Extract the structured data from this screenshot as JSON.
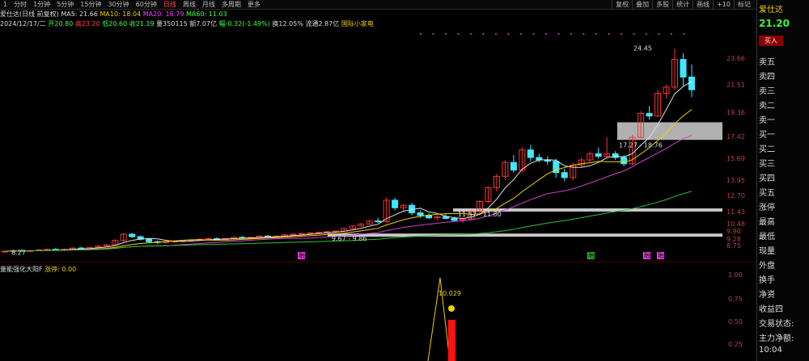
{
  "topbar": {
    "tabs": [
      "1",
      "分时",
      "1分钟",
      "5分钟",
      "15分钟",
      "30分钟",
      "60分钟",
      "日线",
      "周线",
      "月线",
      "多周期",
      "更多"
    ],
    "active": "日线",
    "right_tabs": [
      "复权",
      "叠加",
      "多股",
      "统计",
      "画线",
      "+10",
      "标记"
    ]
  },
  "info": {
    "name": "爱仕达(日线 前复权)",
    "ma5": "MA5: 21.66",
    "ma10": "MA10: 18.04",
    "ma20": "MA20: 16.79",
    "ma60": "MA60: 11.03",
    "date": "2024/12/17/二",
    "open": "开20.80",
    "high": "高23.20",
    "low": "低20.60",
    "close": "收21.19",
    "vol": "量350115",
    "amount": "额7.07亿",
    "change": "幅-0.32(-1.49%)",
    "turnover": "换12.05%",
    "float": "流通2.87亿",
    "sector": "国际小家电"
  },
  "right_panel": {
    "stock": "爱仕达",
    "price": "21.20",
    "buy": "买入",
    "rows": [
      "卖五",
      "卖四",
      "卖三",
      "卖二",
      "卖一",
      "买一",
      "买二",
      "买三",
      "买四",
      "买五",
      "涨停",
      "最高",
      "最低",
      "现量",
      "外盘",
      "换手",
      "净资",
      "收益四",
      "交易状态:",
      "主力净额:",
      "10:04"
    ]
  },
  "indicator": {
    "name": "量能强化大阳F",
    "param": "涨停: 0.00",
    "label": "10.029"
  },
  "markers": [
    "融",
    "融",
    "融",
    "融"
  ],
  "colors": {
    "up": "#ff3030",
    "down": "#40e8ff",
    "ma5": "#e0e0e0",
    "ma10": "#f0d000",
    "ma20": "#d040d0",
    "ma60": "#30c030"
  },
  "chart_data": {
    "type": "candlestick",
    "ylim": [
      7.9,
      25.5
    ],
    "y_ticks": [
      8.75,
      9.28,
      9.9,
      10.48,
      11.43,
      12.7,
      13.95,
      15.69,
      17.42,
      19.36,
      21.51,
      23.66
    ],
    "annotations": {
      "high": "24.45",
      "range1": "17.27 - 18.76",
      "range2": "11.57 - 11.80",
      "range3": "9.67 - 9.86",
      "start": "8.27"
    },
    "bands": [
      [
        17.2,
        18.6
      ],
      [
        11.5,
        11.75
      ],
      [
        9.5,
        9.75
      ]
    ],
    "ohlc": [
      [
        8.3,
        8.4,
        8.2,
        8.35
      ],
      [
        8.35,
        8.45,
        8.3,
        8.4
      ],
      [
        8.4,
        8.5,
        8.3,
        8.35
      ],
      [
        8.35,
        8.45,
        8.25,
        8.4
      ],
      [
        8.4,
        8.5,
        8.35,
        8.45
      ],
      [
        8.45,
        8.55,
        8.4,
        8.5
      ],
      [
        8.5,
        8.6,
        8.4,
        8.45
      ],
      [
        8.45,
        8.55,
        8.35,
        8.5
      ],
      [
        8.5,
        8.65,
        8.45,
        8.6
      ],
      [
        8.6,
        8.7,
        8.5,
        8.55
      ],
      [
        8.55,
        8.7,
        8.5,
        8.65
      ],
      [
        8.65,
        8.8,
        8.6,
        8.75
      ],
      [
        8.75,
        8.9,
        8.7,
        8.85
      ],
      [
        8.85,
        9.3,
        8.8,
        9.2
      ],
      [
        9.2,
        9.8,
        9.1,
        9.7
      ],
      [
        9.7,
        9.8,
        9.4,
        9.5
      ],
      [
        9.5,
        9.6,
        9.2,
        9.3
      ],
      [
        9.3,
        9.4,
        9.0,
        9.1
      ],
      [
        9.1,
        9.2,
        8.9,
        9.05
      ],
      [
        9.05,
        9.15,
        8.95,
        9.1
      ],
      [
        9.1,
        9.2,
        9.0,
        9.15
      ],
      [
        9.15,
        9.25,
        9.05,
        9.2
      ],
      [
        9.2,
        9.3,
        9.1,
        9.25
      ],
      [
        9.25,
        9.35,
        9.15,
        9.3
      ],
      [
        9.3,
        9.4,
        9.2,
        9.35
      ],
      [
        9.35,
        9.45,
        9.25,
        9.3
      ],
      [
        9.3,
        9.4,
        9.2,
        9.35
      ],
      [
        9.35,
        9.5,
        9.3,
        9.45
      ],
      [
        9.45,
        9.55,
        9.35,
        9.4
      ],
      [
        9.4,
        9.5,
        9.3,
        9.45
      ],
      [
        9.45,
        9.6,
        9.4,
        9.55
      ],
      [
        9.55,
        9.65,
        9.45,
        9.5
      ],
      [
        9.5,
        9.6,
        9.4,
        9.55
      ],
      [
        9.55,
        9.7,
        9.5,
        9.65
      ],
      [
        9.65,
        9.75,
        9.55,
        9.7
      ],
      [
        9.7,
        9.8,
        9.6,
        9.75
      ],
      [
        9.75,
        9.85,
        9.65,
        9.8
      ],
      [
        9.8,
        9.9,
        9.7,
        9.85
      ],
      [
        9.85,
        9.95,
        9.75,
        9.9
      ],
      [
        9.9,
        10.0,
        9.8,
        9.95
      ],
      [
        9.95,
        10.2,
        9.9,
        10.15
      ],
      [
        10.15,
        10.4,
        10.1,
        10.35
      ],
      [
        10.35,
        10.6,
        10.3,
        10.5
      ],
      [
        10.5,
        10.8,
        10.45,
        10.75
      ],
      [
        10.75,
        11.0,
        10.6,
        10.7
      ],
      [
        10.7,
        12.6,
        10.6,
        12.4
      ],
      [
        12.4,
        12.6,
        11.6,
        11.8
      ],
      [
        11.8,
        12.1,
        11.5,
        12.0
      ],
      [
        12.0,
        12.2,
        11.2,
        11.4
      ],
      [
        11.4,
        11.6,
        11.0,
        11.2
      ],
      [
        11.2,
        11.4,
        10.9,
        11.0
      ],
      [
        11.0,
        11.2,
        10.8,
        11.1
      ],
      [
        11.1,
        11.3,
        10.9,
        10.95
      ],
      [
        10.95,
        11.1,
        10.7,
        10.8
      ],
      [
        10.8,
        11.0,
        10.6,
        10.9
      ],
      [
        10.9,
        11.6,
        10.8,
        11.5
      ],
      [
        11.5,
        12.4,
        11.4,
        12.3
      ],
      [
        12.3,
        13.5,
        12.2,
        13.4
      ],
      [
        13.4,
        14.5,
        13.1,
        14.3
      ],
      [
        14.3,
        15.6,
        14.0,
        15.4
      ],
      [
        15.4,
        16.0,
        14.6,
        14.8
      ],
      [
        14.8,
        16.6,
        14.6,
        16.4
      ],
      [
        16.4,
        16.8,
        15.5,
        15.8
      ],
      [
        15.8,
        16.1,
        15.4,
        15.6
      ],
      [
        15.6,
        15.9,
        15.2,
        15.5
      ],
      [
        15.5,
        15.7,
        14.2,
        14.6
      ],
      [
        14.6,
        14.9,
        13.9,
        14.2
      ],
      [
        14.2,
        15.4,
        14.0,
        15.2
      ],
      [
        15.2,
        15.8,
        15.0,
        15.6
      ],
      [
        15.6,
        16.3,
        15.4,
        16.1
      ],
      [
        16.1,
        16.6,
        15.7,
        15.9
      ],
      [
        15.9,
        17.4,
        15.8,
        16.1
      ],
      [
        16.1,
        16.3,
        15.6,
        15.8
      ],
      [
        15.8,
        16.0,
        15.1,
        15.3
      ],
      [
        15.3,
        17.6,
        15.2,
        17.4
      ],
      [
        17.4,
        19.5,
        17.3,
        19.3
      ],
      [
        19.3,
        19.9,
        18.8,
        19.1
      ],
      [
        19.1,
        21.2,
        19.0,
        20.9
      ],
      [
        20.9,
        21.6,
        20.5,
        21.4
      ],
      [
        21.4,
        24.45,
        21.2,
        23.6
      ],
      [
        23.6,
        24.1,
        21.5,
        22.2
      ],
      [
        22.2,
        23.2,
        20.6,
        21.19
      ]
    ]
  }
}
